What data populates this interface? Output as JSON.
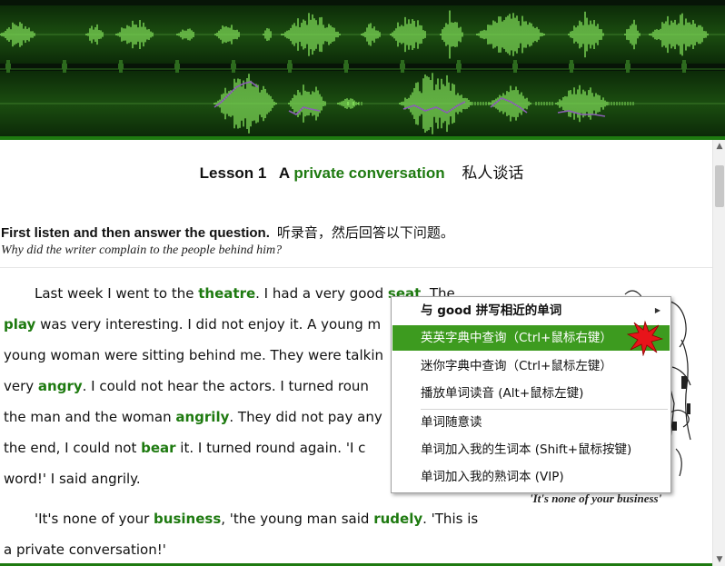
{
  "lesson": {
    "label": "Lesson 1",
    "letter": "A",
    "title_en": "private conversation",
    "title_cn": "私人谈话"
  },
  "question": {
    "bold": "First listen and then answer the question.",
    "cn": "听录音，然后回答以下问题。",
    "sub": "Why did the writer complain to the people behind him?"
  },
  "body": [
    [
      {
        "t": "Last week I went to the "
      },
      {
        "t": "theatre",
        "k": 1
      },
      {
        "t": ". I had a very good "
      },
      {
        "t": "seat",
        "k": 1
      },
      {
        "t": ". The"
      }
    ],
    [
      {
        "t": "play",
        "k": 1
      },
      {
        "t": " was very interesting. I did not enjoy it. A young m"
      }
    ],
    [
      {
        "t": "young woman were sitting behind me. They were talkin"
      }
    ],
    [
      {
        "t": "very "
      },
      {
        "t": "angry",
        "k": 1
      },
      {
        "t": ". I could not hear the actors. I turned roun"
      }
    ],
    [
      {
        "t": "the man and the woman "
      },
      {
        "t": "angrily",
        "k": 1
      },
      {
        "t": ". They did not pay any"
      }
    ],
    [
      {
        "t": "the end, I could not "
      },
      {
        "t": "bear",
        "k": 1
      },
      {
        "t": " it. I turned round again. 'I c"
      }
    ],
    [
      {
        "t": "word!' I said angrily."
      }
    ],
    [
      {
        "t": "'It's none of your "
      },
      {
        "t": "business",
        "k": 1
      },
      {
        "t": ", 'the young man said "
      },
      {
        "t": "rudely",
        "k": 1
      },
      {
        "t": ". 'This is"
      }
    ],
    [
      {
        "t": "a private conversation!'"
      }
    ]
  ],
  "picture_caption": "'It's none of your business'",
  "context_menu": {
    "header": "与 good 拼写相近的单词",
    "items": [
      "英英字典中查询（Ctrl+鼠标右键）",
      "迷你字典中查询（Ctrl+鼠标左键）",
      "播放单词读音     (Alt+鼠标左键)",
      "单词随意读",
      "单词加入我的生词本 (Shift+鼠标按键)",
      "单词加入我的熟词本 (VIP)"
    ],
    "selected_index": 0
  },
  "colors": {
    "keyword": "#1e7a10",
    "menu_highlight": "#3d9b1f",
    "wave_bg": "#071407",
    "wave_green": "#7ed957"
  }
}
